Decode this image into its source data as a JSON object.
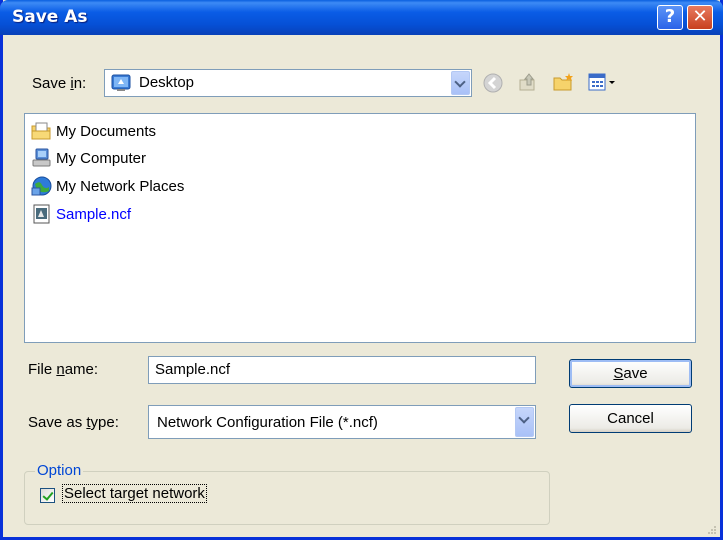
{
  "window": {
    "title": "Save As",
    "help_glyph": "?",
    "close_glyph": "✕"
  },
  "save_in": {
    "label_pre": "Save ",
    "label_access": "i",
    "label_post": "n:",
    "value": "Desktop",
    "icon": "desktop-icon"
  },
  "toolbar": {
    "icons": [
      "back-icon",
      "up-folder-icon",
      "new-folder-icon",
      "views-menu-icon"
    ]
  },
  "files": [
    {
      "name": "My Documents",
      "icon": "my-documents-icon",
      "color": "#000000"
    },
    {
      "name": "My Computer",
      "icon": "my-computer-icon",
      "color": "#000000"
    },
    {
      "name": "My Network Places",
      "icon": "network-places-icon",
      "color": "#000000"
    },
    {
      "name": "Sample.ncf",
      "icon": "ncf-file-icon",
      "color": "#0000FF"
    }
  ],
  "file_name": {
    "label_pre": "File ",
    "label_access": "n",
    "label_post": "ame:",
    "value": "Sample.ncf"
  },
  "save_type": {
    "label_pre": "Save as ",
    "label_access": "t",
    "label_post": "ype:",
    "value": "Network Configuration File (*.ncf)"
  },
  "buttons": {
    "save_access": "S",
    "save_rest": "ave",
    "cancel": "Cancel"
  },
  "option": {
    "group_label": "Option",
    "checkbox_label": "Select target network",
    "checked": true
  },
  "colors": {
    "titlebar": "#0A5CE6",
    "dialog_bg": "#ECE9D8",
    "group_label": "#0046D5",
    "file_link": "#0000FF"
  }
}
